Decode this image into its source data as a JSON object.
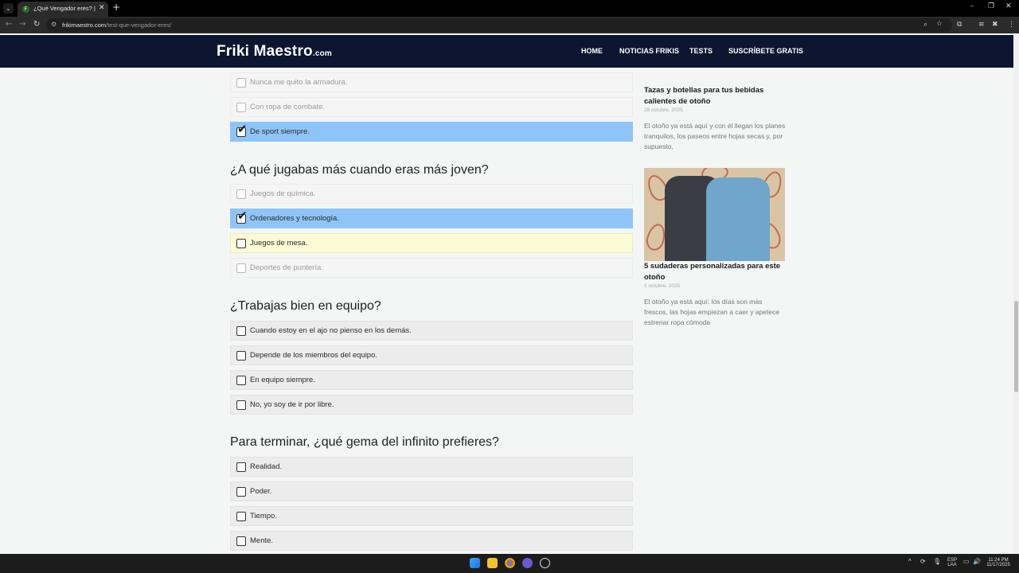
{
  "browser": {
    "tab_title": "¿Qué Vengador eres? | Descub",
    "url_domain": "frikimaestro.com",
    "url_path": "/test-que-vengador-eres/"
  },
  "site": {
    "logo_main": "Friki Maestro",
    "logo_suffix": ".com",
    "menu": [
      "HOME",
      "NOTICIAS FRIKIS",
      "TESTS",
      "SUSCRÍBETE GRATIS"
    ]
  },
  "quiz": {
    "prev_options": [
      {
        "label": "Nunca me quito la armadura.",
        "state": "faded"
      },
      {
        "label": "Con ropa de combate.",
        "state": "faded"
      },
      {
        "label": "De sport siempre.",
        "state": "selected"
      }
    ],
    "q1": {
      "title": "¿A qué jugabas más cuando eras más joven?",
      "options": [
        {
          "label": "Juegos de química.",
          "state": "faded"
        },
        {
          "label": "Ordenadores y tecnología.",
          "state": "selected"
        },
        {
          "label": "Juegos de mesa.",
          "state": "hover"
        },
        {
          "label": "Deportes de puntería.",
          "state": "faded"
        }
      ]
    },
    "q2": {
      "title": "¿Trabajas bien en equipo?",
      "options": [
        {
          "label": "Cuando estoy en el ajo no pienso en los demás.",
          "state": "normal"
        },
        {
          "label": "Depende de los miembros del equipo.",
          "state": "normal"
        },
        {
          "label": "En equipo siempre.",
          "state": "normal"
        },
        {
          "label": "No, yo soy de ir por libre.",
          "state": "normal"
        }
      ]
    },
    "q3": {
      "title": "Para terminar, ¿qué gema del infinito prefieres?",
      "options": [
        {
          "label": "Realidad.",
          "state": "normal"
        },
        {
          "label": "Poder.",
          "state": "normal"
        },
        {
          "label": "Tiempo.",
          "state": "normal"
        },
        {
          "label": "Mente.",
          "state": "normal"
        }
      ]
    }
  },
  "sidebar": {
    "post1": {
      "title": "Tazas y botellas para tus bebidas calientes de otoño",
      "date": "28 octubre, 2025",
      "excerpt": "El otoño ya está aquí y con él llegan los planes tranquilos, los paseos entre hojas secas y, por supuesto,"
    },
    "post2": {
      "title": "5 sudaderas personalizadas para este otoño",
      "date": "1 octubre, 2025",
      "excerpt": "El otoño ya está aquí: los días son más frescos, las hojas empiezan a caer y apetece estrenar ropa cómoda"
    }
  },
  "taskbar": {
    "lang_top": "ESP",
    "lang_bottom": "LAA",
    "time": "11:24 PM",
    "date": "11/17/2025"
  },
  "colors": {
    "header_bg": "#0c1631",
    "selected_bg": "#8fc4f8",
    "hover_bg": "#fbfbd5"
  }
}
